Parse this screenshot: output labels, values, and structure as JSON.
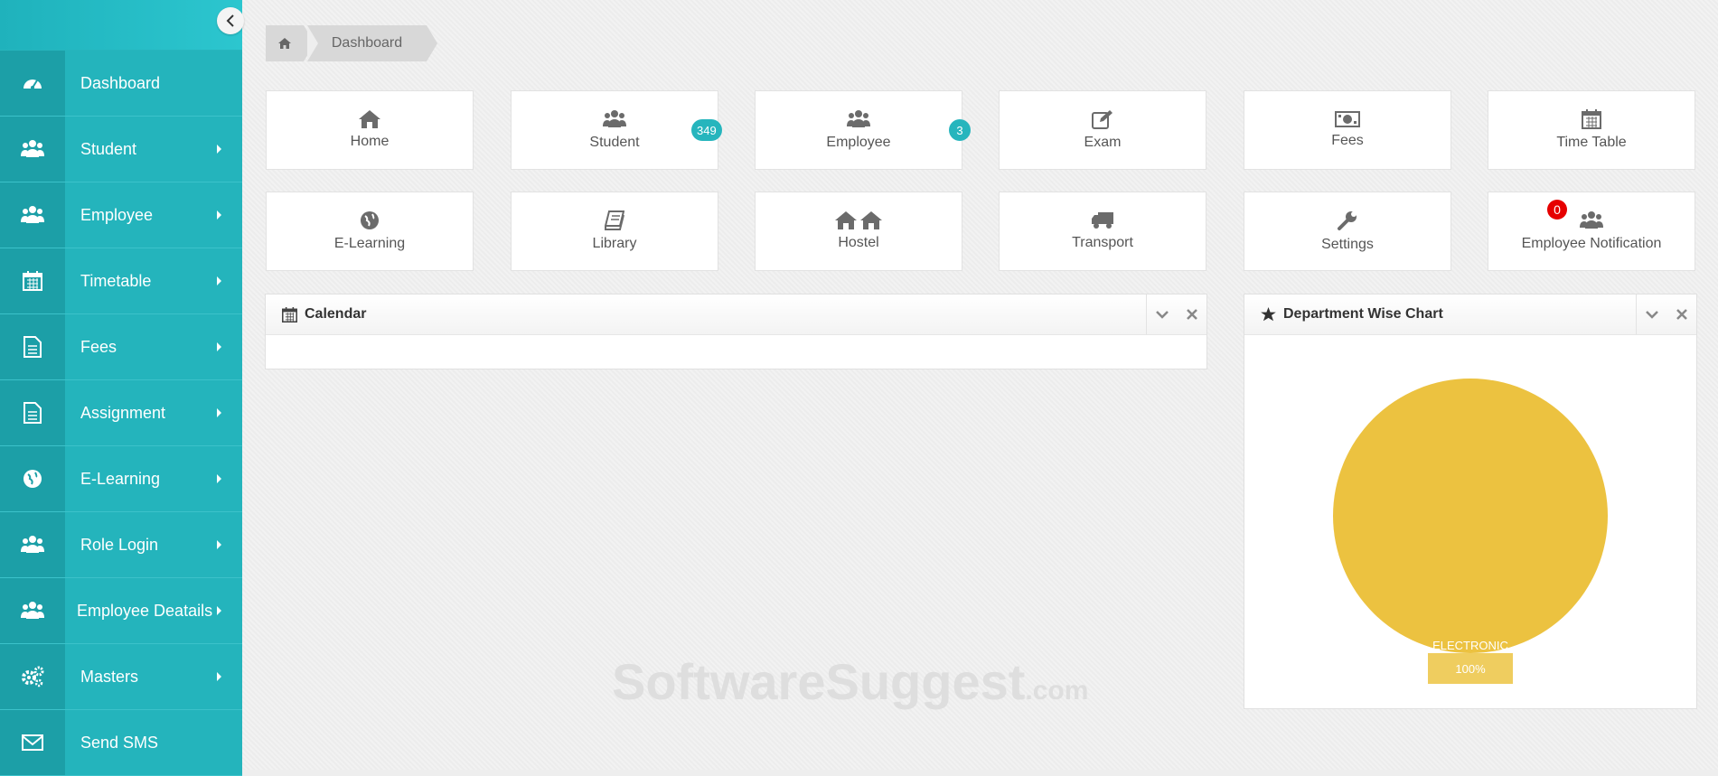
{
  "sidebar": {
    "items": [
      {
        "label": "Dashboard",
        "icon": "dashboard-gauge-icon",
        "has_arrow": false
      },
      {
        "label": "Student",
        "icon": "users-icon",
        "has_arrow": true
      },
      {
        "label": "Employee",
        "icon": "users-icon",
        "has_arrow": true
      },
      {
        "label": "Timetable",
        "icon": "calendar-icon",
        "has_arrow": true
      },
      {
        "label": "Fees",
        "icon": "document-icon",
        "has_arrow": true
      },
      {
        "label": "Assignment",
        "icon": "document-icon",
        "has_arrow": true
      },
      {
        "label": "E-Learning",
        "icon": "globe-icon",
        "has_arrow": true
      },
      {
        "label": "Role Login",
        "icon": "users-icon",
        "has_arrow": true
      },
      {
        "label": "Employee Deatails",
        "icon": "users-icon",
        "has_arrow": true
      },
      {
        "label": "Masters",
        "icon": "gears-icon",
        "has_arrow": true
      },
      {
        "label": "Send SMS",
        "icon": "envelope-icon",
        "has_arrow": false
      }
    ]
  },
  "breadcrumb": {
    "current": "Dashboard"
  },
  "tiles": [
    {
      "label": "Home",
      "icon": "home-icon"
    },
    {
      "label": "Student",
      "icon": "users-icon",
      "badge": "349"
    },
    {
      "label": "Employee",
      "icon": "users-icon",
      "badge": "3"
    },
    {
      "label": "Exam",
      "icon": "edit-icon"
    },
    {
      "label": "Fees",
      "icon": "money-icon"
    },
    {
      "label": "Time Table",
      "icon": "calendar-icon"
    },
    {
      "label": "E-Learning",
      "icon": "globe-icon"
    },
    {
      "label": "Library",
      "icon": "book-icon"
    },
    {
      "label": "Hostel",
      "icon": "hostel-icon"
    },
    {
      "label": "Transport",
      "icon": "truck-icon"
    },
    {
      "label": "Settings",
      "icon": "wrench-icon"
    },
    {
      "label": "Employee Notification",
      "icon": "users-icon",
      "badge": "0"
    }
  ],
  "calendar_panel": {
    "title": "Calendar"
  },
  "chart_panel": {
    "title": "Department Wise Chart"
  },
  "chart_data": {
    "type": "pie",
    "slices": [
      {
        "label": "ELECTRONIC",
        "value": 100,
        "display": "100%",
        "color": "#ecc240"
      }
    ]
  },
  "watermark": {
    "main": "SoftwareSuggest",
    "suffix": ".com"
  },
  "colors": {
    "sidebar": "#26b5bd",
    "accent": "#26b5bd",
    "pie": "#ecc240",
    "badge_red": "#e60000"
  }
}
